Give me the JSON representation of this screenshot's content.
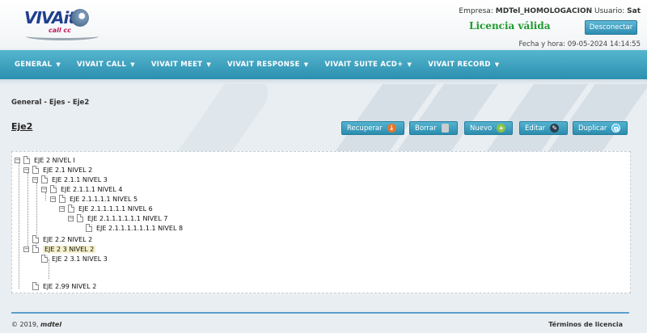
{
  "header": {
    "logo_text": "VIVAit",
    "logo_sub": "call cc",
    "empresa_label": "Empresa:",
    "empresa_value": "MDTel_HOMOLOGACION",
    "usuario_label": "Usuario:",
    "usuario_value": "Sat",
    "disconnect_label": "Desconectar",
    "license_status": "Licencia válida",
    "datetime_label": "Fecha y hora:",
    "datetime_value": "09-05-2024 14:14:55"
  },
  "nav": {
    "items": [
      {
        "label": "GENERAL"
      },
      {
        "label": "VIVAIT CALL"
      },
      {
        "label": "VIVAIT MEET"
      },
      {
        "label": "VIVAIT RESPONSE"
      },
      {
        "label": "VIVAIT SUITE ACD+"
      },
      {
        "label": "VIVAIT RECORD"
      }
    ]
  },
  "breadcrumb": "General - Ejes - Eje2",
  "page_title": "Eje2",
  "toolbar": {
    "recuperar": "Recuperar",
    "borrar": "Borrar",
    "nuevo": "Nuevo",
    "editar": "Editar",
    "duplicar": "Duplicar"
  },
  "tree": {
    "nodes": [
      {
        "label": "EJE 2 NIVEL I",
        "expanded": true
      },
      {
        "label": "EJE 2.1 NIVEL 2",
        "expanded": true
      },
      {
        "label": "EJE 2.1.1 NIVEL 3",
        "expanded": true
      },
      {
        "label": "EJE 2.1.1.1 NIVEL 4",
        "expanded": true
      },
      {
        "label": "EJE 2.1.1.1.1 NIVEL 5",
        "expanded": true
      },
      {
        "label": "EJE 2.1.1.1.1.1 NIVEL 6",
        "expanded": true
      },
      {
        "label": "EJE 2.1.1.1.1.1.1 NIVEL 7",
        "expanded": true
      },
      {
        "label": "EJE 2.1.1.1.1.1.1.1 NIVEL 8",
        "expanded": false
      },
      {
        "label": "EJE 2.2 NIVEL 2",
        "expanded": false
      },
      {
        "label": "EJE 2 3 NIVEL 2",
        "expanded": true,
        "selected": true
      },
      {
        "label": "EJE 2 3.1 NIVEL 3",
        "expanded": false
      },
      {
        "label": "EJE 2.99 NIVEL 2",
        "expanded": false
      }
    ]
  },
  "footer": {
    "copyright_prefix": "© 2019,",
    "copyright_brand": "mdtel",
    "terms_label": "Términos de licencia"
  },
  "colors": {
    "nav_bar": "#3fa2c2",
    "license_ok": "#1e9b2e",
    "button": "#3a9dbf"
  }
}
